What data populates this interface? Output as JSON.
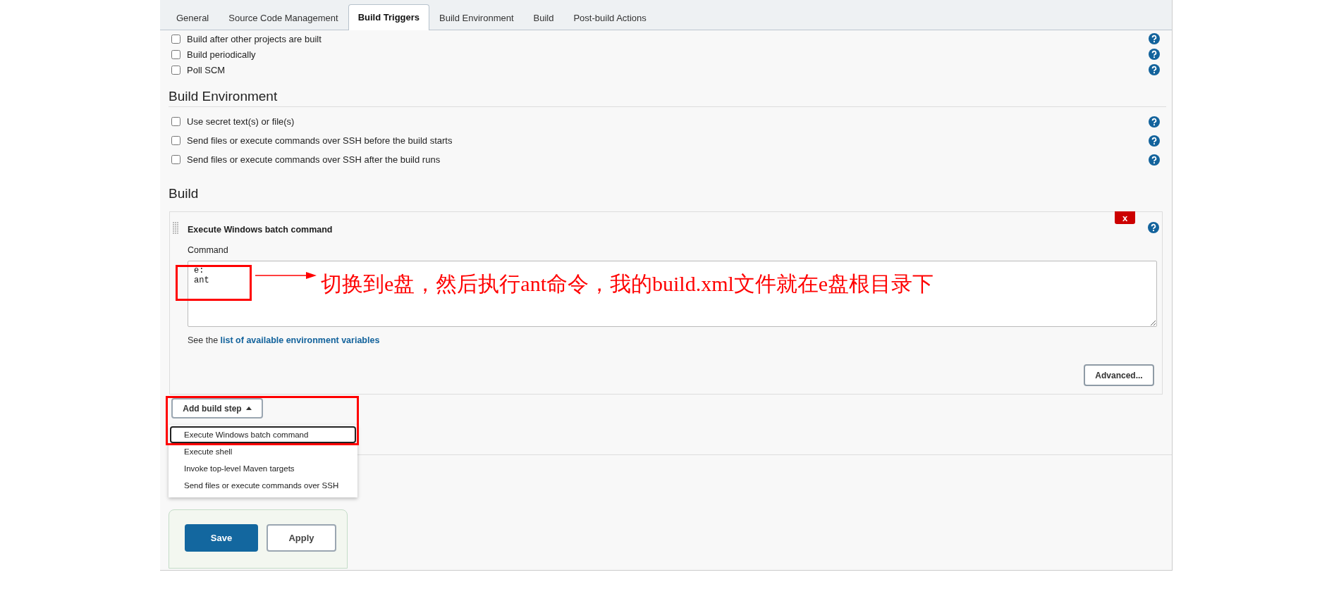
{
  "tabs": [
    {
      "label": "General",
      "selected": false
    },
    {
      "label": "Source Code Management",
      "selected": false
    },
    {
      "label": "Build Triggers",
      "selected": true
    },
    {
      "label": "Build Environment",
      "selected": false
    },
    {
      "label": "Build",
      "selected": false
    },
    {
      "label": "Post-build Actions",
      "selected": false
    }
  ],
  "build_triggers": {
    "items": [
      {
        "label": "Build after other projects are built",
        "checked": false
      },
      {
        "label": "Build periodically",
        "checked": false
      },
      {
        "label": "Poll SCM",
        "checked": false
      }
    ]
  },
  "build_environment": {
    "heading": "Build Environment",
    "items": [
      {
        "label": "Use secret text(s) or file(s)",
        "checked": false
      },
      {
        "label": "Send files or execute commands over SSH before the build starts",
        "checked": false
      },
      {
        "label": "Send files or execute commands over SSH after the build runs",
        "checked": false
      }
    ]
  },
  "build": {
    "heading": "Build",
    "step": {
      "title": "Execute Windows batch command",
      "delete_button": "x",
      "field_label": "Command",
      "value": "e:\nant",
      "hint": "See the ",
      "hint_link": "list of available environment variables",
      "advanced_button": "Advanced..."
    },
    "add_step_button": "Add build step",
    "menu": [
      {
        "label": "Execute Windows batch command",
        "selected": true
      },
      {
        "label": "Execute shell",
        "selected": false
      },
      {
        "label": "Invoke top-level Maven targets",
        "selected": false
      },
      {
        "label": "Send files or execute commands over SSH",
        "selected": false
      }
    ]
  },
  "buttons": [
    {
      "label": "Save",
      "kind": "primary"
    },
    {
      "label": "Apply",
      "kind": "secondary"
    }
  ],
  "annotation": {
    "text": "切换到e盘，然后执行ant命令，我的build.xml文件就在e盘根目录下"
  }
}
